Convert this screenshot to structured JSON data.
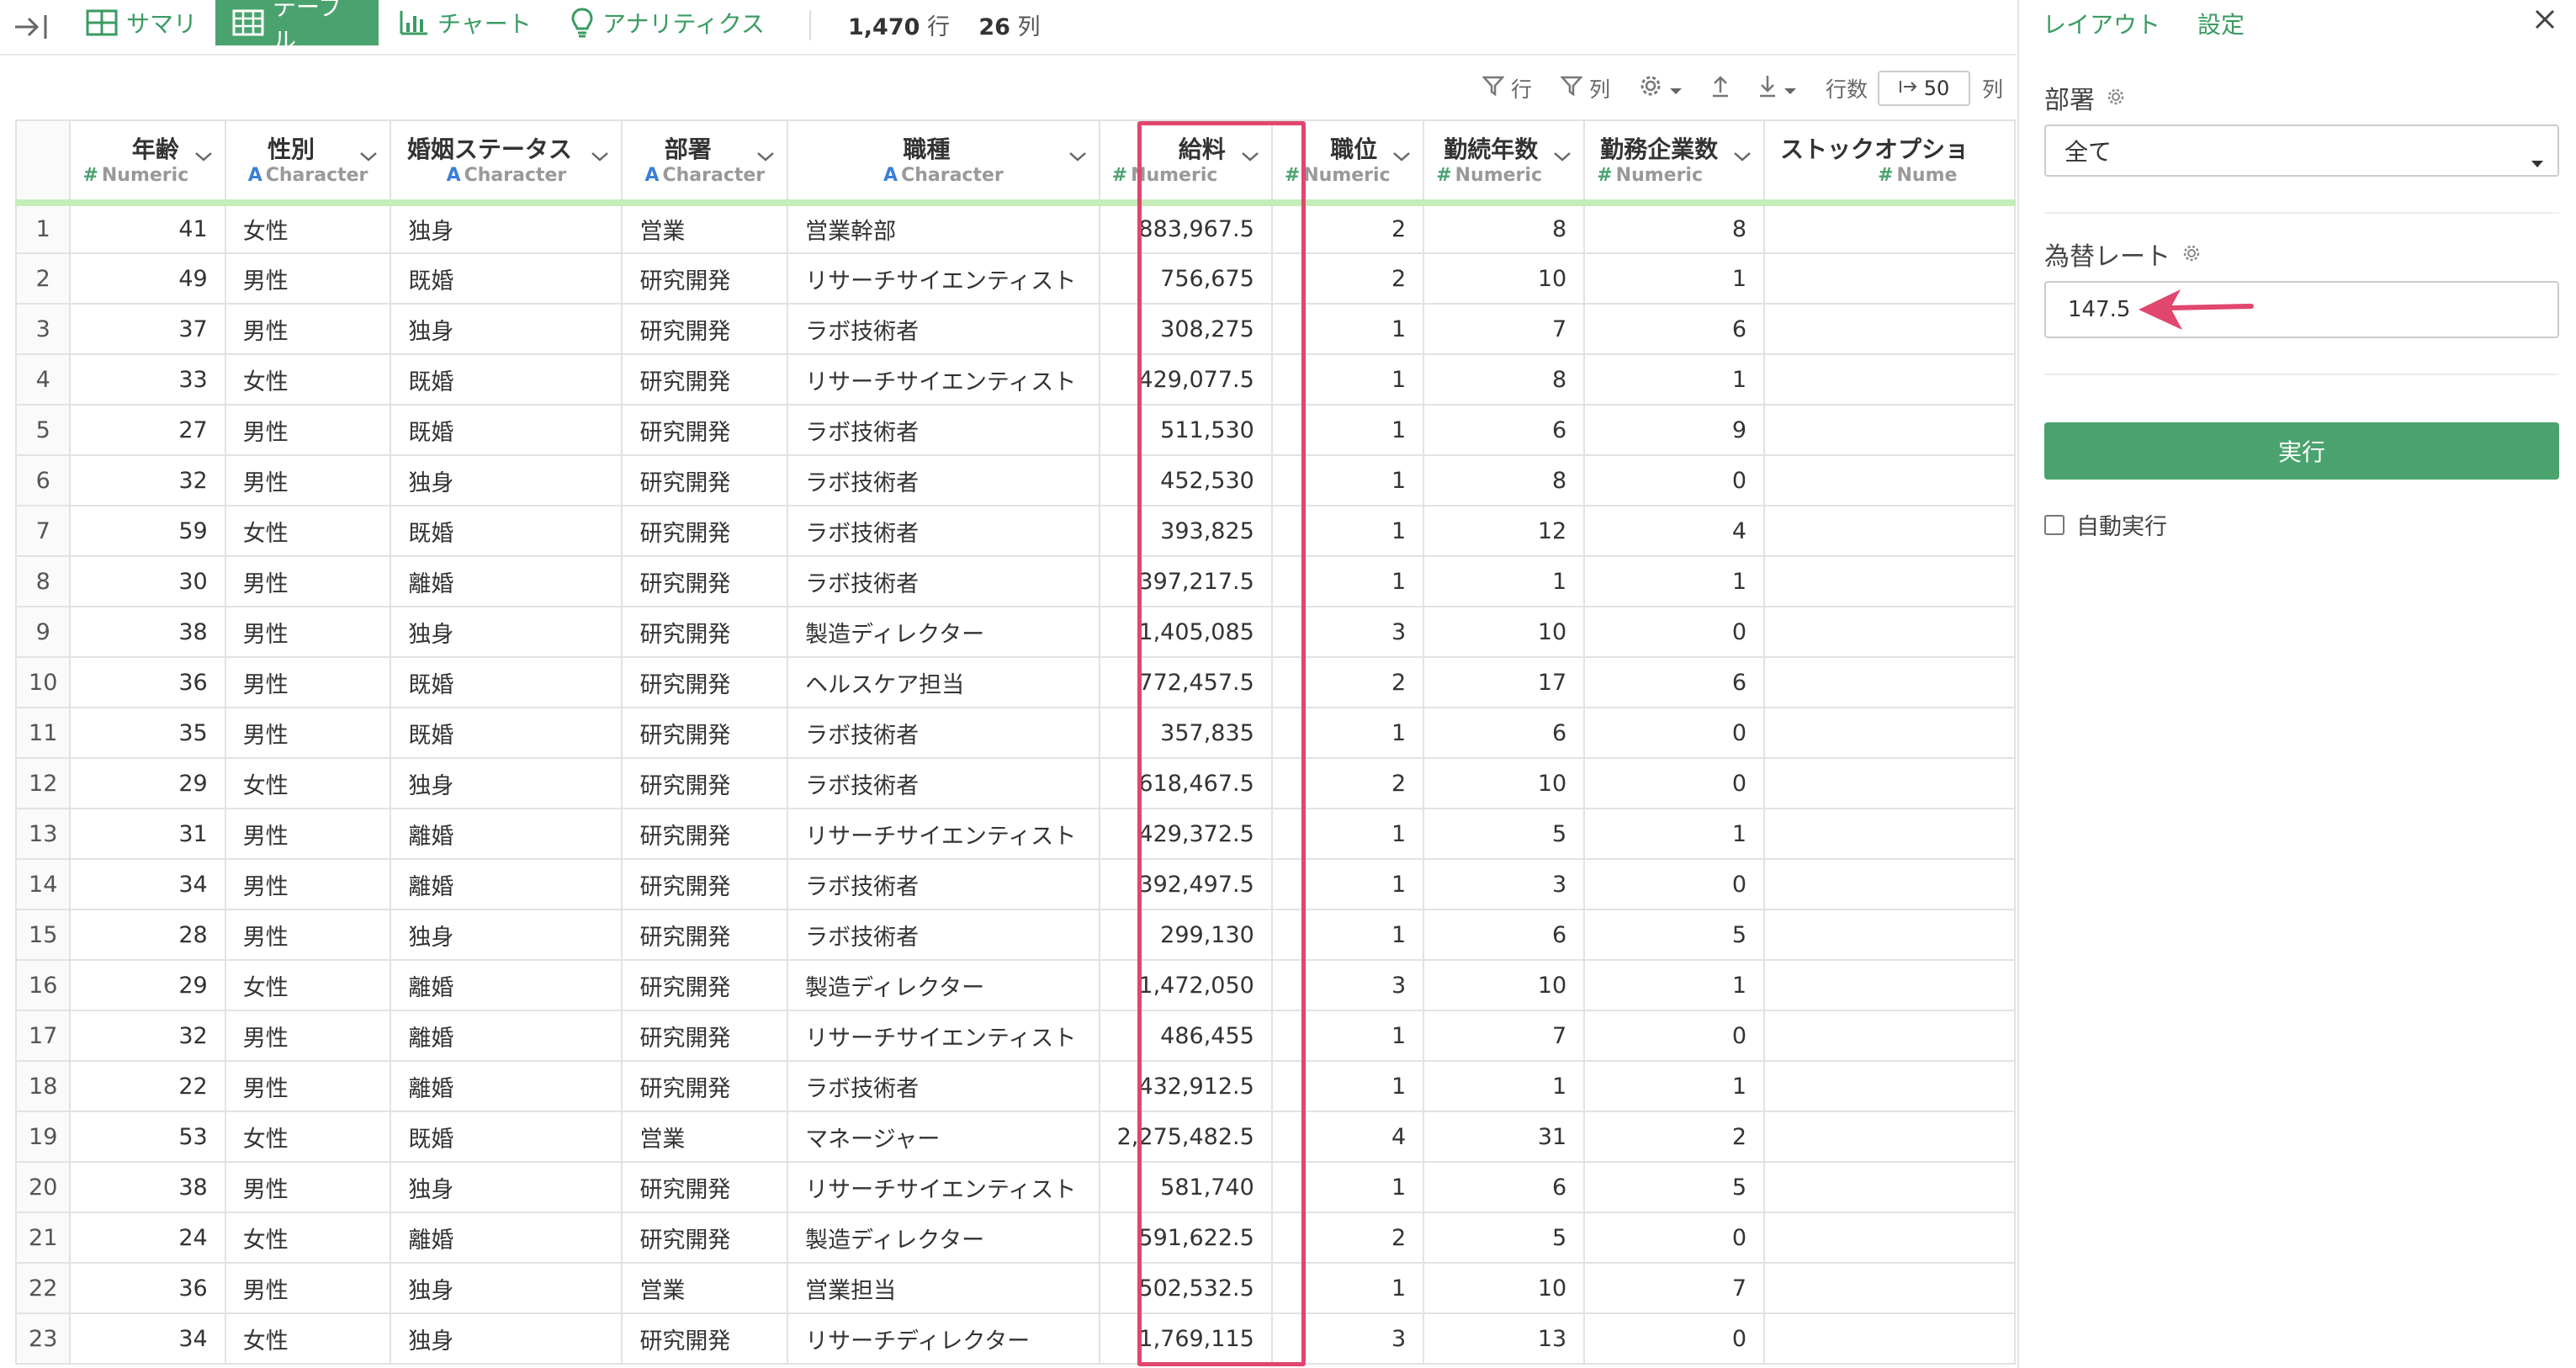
{
  "toolbar": {
    "tabs": [
      {
        "label": "サマリ"
      },
      {
        "label": "テーブル"
      },
      {
        "label": "チャート"
      },
      {
        "label": "アナリティクス"
      }
    ],
    "row_count": "1,470",
    "row_unit": "行",
    "col_count": "26",
    "col_unit": "列"
  },
  "subbar": {
    "row_filter_label": "行",
    "col_filter_label": "列",
    "rows_label": "行数",
    "rows_value": "50",
    "trailing_label": "列"
  },
  "columns": [
    {
      "name": "年齢",
      "type": "Numeric"
    },
    {
      "name": "性別",
      "type": "Character"
    },
    {
      "name": "婚姻ステータス",
      "type": "Character"
    },
    {
      "name": "部署",
      "type": "Character"
    },
    {
      "name": "職種",
      "type": "Character"
    },
    {
      "name": "給料",
      "type": "Numeric"
    },
    {
      "name": "職位",
      "type": "Numeric"
    },
    {
      "name": "勤続年数",
      "type": "Numeric"
    },
    {
      "name": "勤務企業数",
      "type": "Numeric"
    },
    {
      "name": "ストックオプショ",
      "type": "Nume"
    }
  ],
  "rows": [
    [
      "1",
      "41",
      "女性",
      "独身",
      "営業",
      "営業幹部",
      "883,967.5",
      "2",
      "8",
      "8"
    ],
    [
      "2",
      "49",
      "男性",
      "既婚",
      "研究開発",
      "リサーチサイエンティスト",
      "756,675",
      "2",
      "10",
      "1"
    ],
    [
      "3",
      "37",
      "男性",
      "独身",
      "研究開発",
      "ラボ技術者",
      "308,275",
      "1",
      "7",
      "6"
    ],
    [
      "4",
      "33",
      "女性",
      "既婚",
      "研究開発",
      "リサーチサイエンティスト",
      "429,077.5",
      "1",
      "8",
      "1"
    ],
    [
      "5",
      "27",
      "男性",
      "既婚",
      "研究開発",
      "ラボ技術者",
      "511,530",
      "1",
      "6",
      "9"
    ],
    [
      "6",
      "32",
      "男性",
      "独身",
      "研究開発",
      "ラボ技術者",
      "452,530",
      "1",
      "8",
      "0"
    ],
    [
      "7",
      "59",
      "女性",
      "既婚",
      "研究開発",
      "ラボ技術者",
      "393,825",
      "1",
      "12",
      "4"
    ],
    [
      "8",
      "30",
      "男性",
      "離婚",
      "研究開発",
      "ラボ技術者",
      "397,217.5",
      "1",
      "1",
      "1"
    ],
    [
      "9",
      "38",
      "男性",
      "独身",
      "研究開発",
      "製造ディレクター",
      "1,405,085",
      "3",
      "10",
      "0"
    ],
    [
      "10",
      "36",
      "男性",
      "既婚",
      "研究開発",
      "ヘルスケア担当",
      "772,457.5",
      "2",
      "17",
      "6"
    ],
    [
      "11",
      "35",
      "男性",
      "既婚",
      "研究開発",
      "ラボ技術者",
      "357,835",
      "1",
      "6",
      "0"
    ],
    [
      "12",
      "29",
      "女性",
      "独身",
      "研究開発",
      "ラボ技術者",
      "618,467.5",
      "2",
      "10",
      "0"
    ],
    [
      "13",
      "31",
      "男性",
      "離婚",
      "研究開発",
      "リサーチサイエンティスト",
      "429,372.5",
      "1",
      "5",
      "1"
    ],
    [
      "14",
      "34",
      "男性",
      "離婚",
      "研究開発",
      "ラボ技術者",
      "392,497.5",
      "1",
      "3",
      "0"
    ],
    [
      "15",
      "28",
      "男性",
      "独身",
      "研究開発",
      "ラボ技術者",
      "299,130",
      "1",
      "6",
      "5"
    ],
    [
      "16",
      "29",
      "女性",
      "離婚",
      "研究開発",
      "製造ディレクター",
      "1,472,050",
      "3",
      "10",
      "1"
    ],
    [
      "17",
      "32",
      "男性",
      "離婚",
      "研究開発",
      "リサーチサイエンティスト",
      "486,455",
      "1",
      "7",
      "0"
    ],
    [
      "18",
      "22",
      "男性",
      "離婚",
      "研究開発",
      "ラボ技術者",
      "432,912.5",
      "1",
      "1",
      "1"
    ],
    [
      "19",
      "53",
      "女性",
      "既婚",
      "営業",
      "マネージャー",
      "2,275,482.5",
      "4",
      "31",
      "2"
    ],
    [
      "20",
      "38",
      "男性",
      "独身",
      "研究開発",
      "リサーチサイエンティスト",
      "581,740",
      "1",
      "6",
      "5"
    ],
    [
      "21",
      "24",
      "女性",
      "離婚",
      "研究開発",
      "製造ディレクター",
      "591,622.5",
      "2",
      "5",
      "0"
    ],
    [
      "22",
      "36",
      "男性",
      "独身",
      "営業",
      "営業担当",
      "502,532.5",
      "1",
      "10",
      "7"
    ],
    [
      "23",
      "34",
      "女性",
      "独身",
      "研究開発",
      "リサーチディレクター",
      "1,769,115",
      "3",
      "13",
      "0"
    ]
  ],
  "panel": {
    "tabs": [
      {
        "label": "レイアウト"
      },
      {
        "label": "設定"
      }
    ],
    "dept_label": "部署",
    "dept_value": "全て",
    "rate_label": "為替レート",
    "rate_value": "147.5",
    "run_label": "実行",
    "auto_label": "自動実行"
  },
  "colors": {
    "accent": "#4aa36e",
    "highlight": "#e0466e",
    "header_bar": "#c4edb9"
  }
}
